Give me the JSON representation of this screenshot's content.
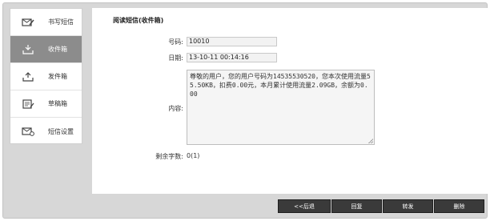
{
  "sidebar": {
    "items": [
      {
        "label": "书写短信",
        "icon": "compose-icon"
      },
      {
        "label": "收件箱",
        "icon": "inbox-icon",
        "active": true
      },
      {
        "label": "发件箱",
        "icon": "outbox-icon"
      },
      {
        "label": "草稿箱",
        "icon": "drafts-icon"
      },
      {
        "label": "短信设置",
        "icon": "sms-settings-icon"
      }
    ]
  },
  "main": {
    "title": "阅读短信(收件箱)",
    "number_label": "号码:",
    "number_value": "10010",
    "date_label": "日期:",
    "date_value": "13-10-11 00:14:16",
    "content_label": "内容:",
    "content_value": "尊敬的用户，您的用户号码为14535530520，您本次使用流量55.50KB，扣费0.00元，本月累计使用流量2.09GB，余额为0.00",
    "remaining_label": "剩余字数:",
    "remaining_value": "0(1)"
  },
  "buttons": {
    "back": "<<后退",
    "reply": "回复",
    "forward": "转发",
    "delete": "删除"
  }
}
